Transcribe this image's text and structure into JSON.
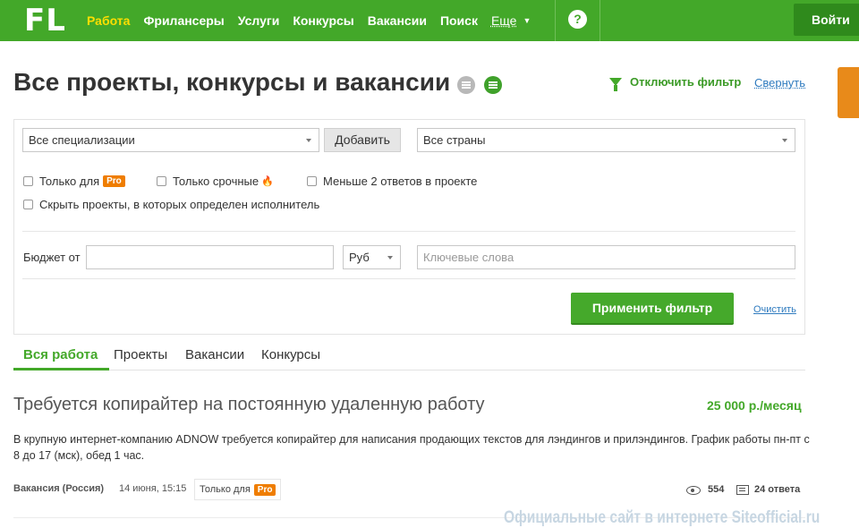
{
  "topbar": {
    "logo": "FL",
    "nav": [
      {
        "label": "Работа"
      },
      {
        "label": "Фрилансеры"
      },
      {
        "label": "Услуги"
      },
      {
        "label": "Конкурсы"
      },
      {
        "label": "Вакансии"
      },
      {
        "label": "Поиск"
      },
      {
        "label": "Еще"
      }
    ],
    "help": "?",
    "login": "Войти"
  },
  "page": {
    "title": "Все проекты, конкурсы и вакансии",
    "filter_off": "Отключить фильтр",
    "collapse": "Свернуть"
  },
  "filter": {
    "specialization": "Все специализации",
    "add": "Добавить",
    "country": "Все страны",
    "only_for": "Только для",
    "pro": "Pro",
    "urgent": "Только срочные",
    "less_answers": "Меньше 2 ответов в проекте",
    "hide_assigned": "Скрыть проекты, в которых определен исполнитель",
    "budget_from": "Бюджет от",
    "budget_value": "",
    "currency": "Руб",
    "keywords_placeholder": "Ключевые слова",
    "apply": "Применить фильтр",
    "clear": "Очистить"
  },
  "tabs": [
    {
      "label": "Вся работа"
    },
    {
      "label": "Проекты"
    },
    {
      "label": "Вакансии"
    },
    {
      "label": "Конкурсы"
    }
  ],
  "project": {
    "title": "Требуется копирайтер на постоянную удаленную работу",
    "price": "25 000 р./месяц",
    "description": "В крупную интернет-компанию ADNOW требуется копирайтер для написания продающих текстов для лэндингов и прилэндингов. График работы пн-пт с 8 до 17 (мск), обед 1 час.",
    "type": "Вакансия (Россия)",
    "date": "14 июня, 15:15",
    "only_for": "Только для",
    "pro": "Pro",
    "views": "554",
    "answers": "24 ответа"
  },
  "watermark": "Официальные сайт в интернете Siteofficial.ru",
  "colors": {
    "brand": "#43a829",
    "active_nav": "#ffde00",
    "pro": "#ef7d00",
    "link": "#2f7bbf"
  }
}
